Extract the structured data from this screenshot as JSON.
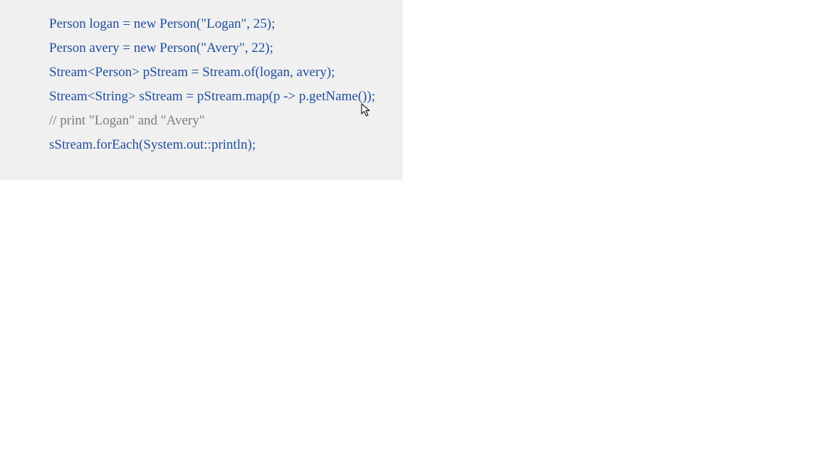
{
  "colors": {
    "panel_background": "#f0f0f0",
    "code_text": "#1f4e9c",
    "comment_text": "#7a7a7a",
    "page_background": "#ffffff"
  },
  "code": {
    "lines": [
      {
        "text": "Person logan = new Person(\"Logan\", 25);",
        "kind": "code"
      },
      {
        "text": "Person avery = new Person(\"Avery\", 22);",
        "kind": "code"
      },
      {
        "text": "Stream<Person> pStream = Stream.of(logan, avery);",
        "kind": "code"
      },
      {
        "text": "Stream<String> sStream = pStream.map(p -> p.getName());",
        "kind": "code"
      },
      {
        "text": "// print \"Logan\" and \"Avery\"",
        "kind": "comment"
      },
      {
        "text": "sStream.forEach(System.out::println);",
        "kind": "code"
      }
    ]
  },
  "cursor": {
    "icon": "mouse-pointer-icon"
  }
}
